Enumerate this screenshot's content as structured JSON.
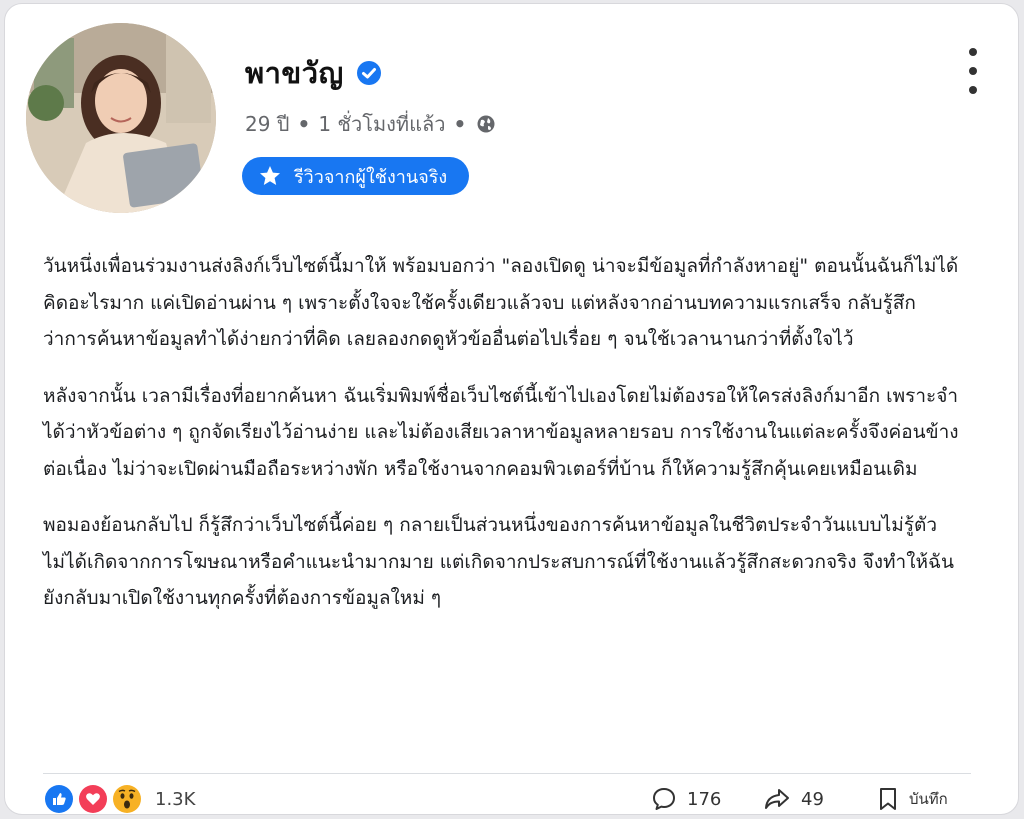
{
  "post": {
    "author_name": "พาขวัญ",
    "age": "29 ปี",
    "time_ago": "1 ชั่วโมงที่แล้ว",
    "badge_label": "รีวิวจากผู้ใช้งานจริง",
    "paragraphs": [
      "วันหนึ่งเพื่อนร่วมงานส่งลิงก์เว็บไซต์นี้มาให้ พร้อมบอกว่า \"ลองเปิดดู น่าจะมีข้อมูลที่กำลังหาอยู่\" ตอนนั้นฉันก็ไม่ได้คิดอะไรมาก แค่เปิดอ่านผ่าน ๆ เพราะตั้งใจจะใช้ครั้งเดียวแล้วจบ แต่หลังจากอ่านบทความแรกเสร็จ กลับรู้สึกว่าการค้นหาข้อมูลทำได้ง่ายกว่าที่คิด เลยลองกดดูหัวข้ออื่นต่อไปเรื่อย ๆ จนใช้เวลานานกว่าที่ตั้งใจไว้",
      "หลังจากนั้น เวลามีเรื่องที่อยากค้นหา ฉันเริ่มพิมพ์ชื่อเว็บไซต์นี้เข้าไปเองโดยไม่ต้องรอให้ใครส่งลิงก์มาอีก เพราะจำได้ว่าหัวข้อต่าง ๆ ถูกจัดเรียงไว้อ่านง่าย และไม่ต้องเสียเวลาหาข้อมูลหลายรอบ การใช้งานในแต่ละครั้งจึงค่อนข้างต่อเนื่อง ไม่ว่าจะเปิดผ่านมือถือระหว่างพัก หรือใช้งานจากคอมพิวเตอร์ที่บ้าน ก็ให้ความรู้สึกคุ้นเคยเหมือนเดิม",
      "พอมองย้อนกลับไป ก็รู้สึกว่าเว็บไซต์นี้ค่อย ๆ กลายเป็นส่วนหนึ่งของการค้นหาข้อมูลในชีวิตประจำวันแบบไม่รู้ตัว ไม่ได้เกิดจากการโฆษณาหรือคำแนะนำมากมาย แต่เกิดจากประสบการณ์ที่ใช้งานแล้วรู้สึกสะดวกจริง จึงทำให้ฉันยังกลับมาเปิดใช้งานทุกครั้งที่ต้องการข้อมูลใหม่ ๆ"
    ]
  },
  "footer": {
    "reaction_count": "1.3K",
    "comment_count": "176",
    "share_count": "49",
    "save_label": "บันทึก"
  },
  "icons": {
    "verified": "verified-check-icon",
    "audience": "globe-icon",
    "badge": "star-icon",
    "more": "more-vertical-icon",
    "reactions": [
      "like-reaction-icon",
      "love-reaction-icon",
      "wow-reaction-icon"
    ],
    "comment": "comment-icon",
    "share": "share-icon",
    "save": "bookmark-icon"
  },
  "colors": {
    "accent": "#1877f2",
    "love": "#f33e58",
    "wow": "#f7b125",
    "muted_text": "#65676b"
  }
}
